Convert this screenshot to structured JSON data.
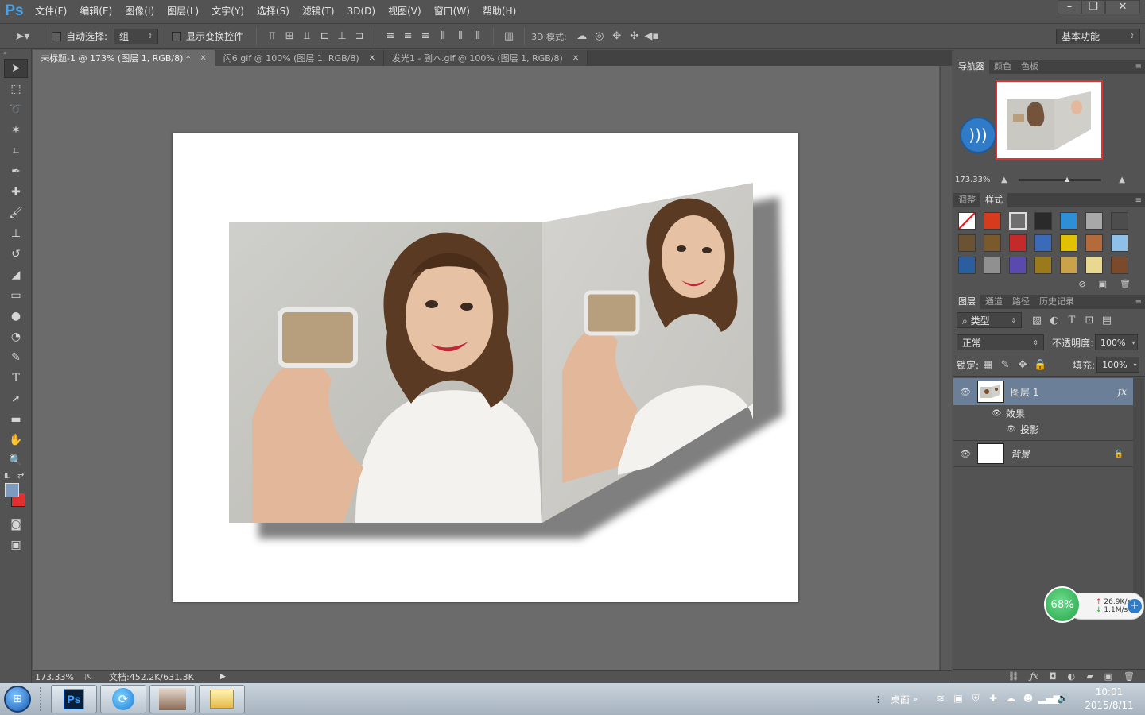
{
  "app": {
    "logo": "Ps",
    "menu": [
      "文件(F)",
      "编辑(E)",
      "图像(I)",
      "图层(L)",
      "文字(Y)",
      "选择(S)",
      "滤镜(T)",
      "3D(D)",
      "视图(V)",
      "窗口(W)",
      "帮助(H)"
    ]
  },
  "options": {
    "auto_select_label": "自动选择:",
    "auto_select_value": "组",
    "show_transform_label": "显示变换控件",
    "mode3d_label": "3D 模式:",
    "workspace_value": "基本功能"
  },
  "tabs": [
    {
      "label": "未标题-1 @ 173% (图层 1, RGB/8) *",
      "active": true
    },
    {
      "label": "闪6.gif @ 100% (图层 1, RGB/8)",
      "active": false
    },
    {
      "label": "发光1 - 副本.gif @ 100% (图层 1, RGB/8)",
      "active": false
    }
  ],
  "status": {
    "zoom": "173.33%",
    "doc_size": "文档:452.2K/631.3K"
  },
  "navigator": {
    "tabs": [
      "导航器",
      "颜色",
      "色板"
    ],
    "zoom": "173.33%"
  },
  "styles": {
    "tabs": [
      "调整",
      "样式"
    ],
    "swatches": [
      "#ffffff",
      "#d83a1e",
      "#6f6f6f",
      "#2a2a2a",
      "#2f8fd6",
      "#a8a8a8",
      "#4d4d4d",
      "#6a5232",
      "#7a5a2a",
      "#c42a2a",
      "#3a6ab8",
      "#e2c200",
      "#b46a3a",
      "#8fc1e8",
      "#2a5e9e",
      "#909090",
      "#5a4ab0",
      "#9a7a1a",
      "#c9a24a",
      "#e8d890",
      "#7a4a2a"
    ]
  },
  "layers": {
    "tabs": [
      "图层",
      "通道",
      "路径",
      "历史记录"
    ],
    "filter_label": "类型",
    "blend_mode": "正常",
    "opacity_label": "不透明度:",
    "opacity_value": "100%",
    "lock_label": "锁定:",
    "fill_label": "填充:",
    "fill_value": "100%",
    "items": [
      {
        "name": "图层 1",
        "fx": "fx"
      },
      {
        "name": "效果"
      },
      {
        "name": "投影"
      },
      {
        "name": "背景"
      }
    ]
  },
  "network": {
    "percent": "68%",
    "up": "26.9K/s",
    "down": "1.1M/s"
  },
  "taskbar": {
    "desktop_label": "桌面",
    "time": "10:01",
    "date": "2015/8/11"
  }
}
